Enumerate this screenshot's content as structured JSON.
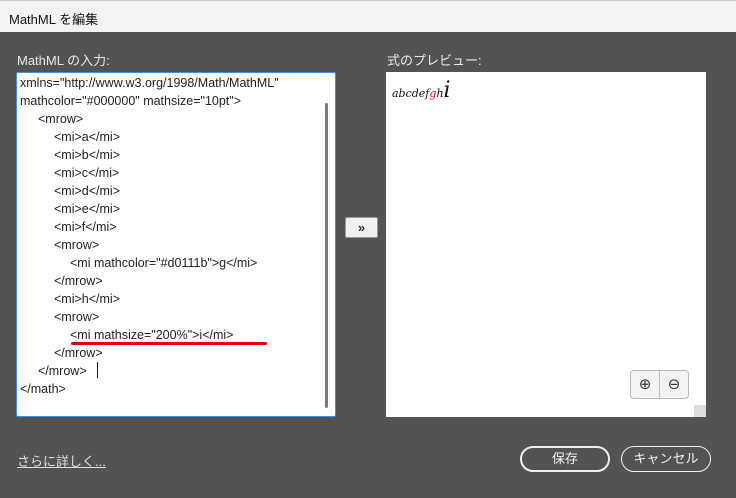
{
  "window": {
    "title": "MathML を編集"
  },
  "input": {
    "label": "MathML の入力:",
    "lines": [
      "xmlns=\"http://www.w3.org/1998/Math/MathML\"",
      "mathcolor=\"#000000\" mathsize=\"10pt\">",
      "<mrow>",
      "<mi>a</mi>",
      "<mi>b</mi>",
      "<mi>c</mi>",
      "<mi>d</mi>",
      "<mi>e</mi>",
      "<mi>f</mi>",
      "<mrow>",
      "<mi mathcolor=\"#d0111b\">g</mi>",
      "</mrow>",
      "<mi>h</mi>",
      "<mrow>",
      "<mi mathsize=\"200%\">i</mi>",
      "</mrow>",
      "</mrow>",
      "</math>"
    ]
  },
  "convert_button": "»",
  "preview": {
    "label": "式のプレビュー:",
    "math_plain": "abcdef",
    "math_colored": "g",
    "math_h": "h",
    "math_big": "i",
    "colored_color": "#d0111b"
  },
  "zoom_in": "⊕",
  "zoom_out": "⊖",
  "learn_more": "さらに詳しく...",
  "save": "保存",
  "cancel": "キャンセル"
}
